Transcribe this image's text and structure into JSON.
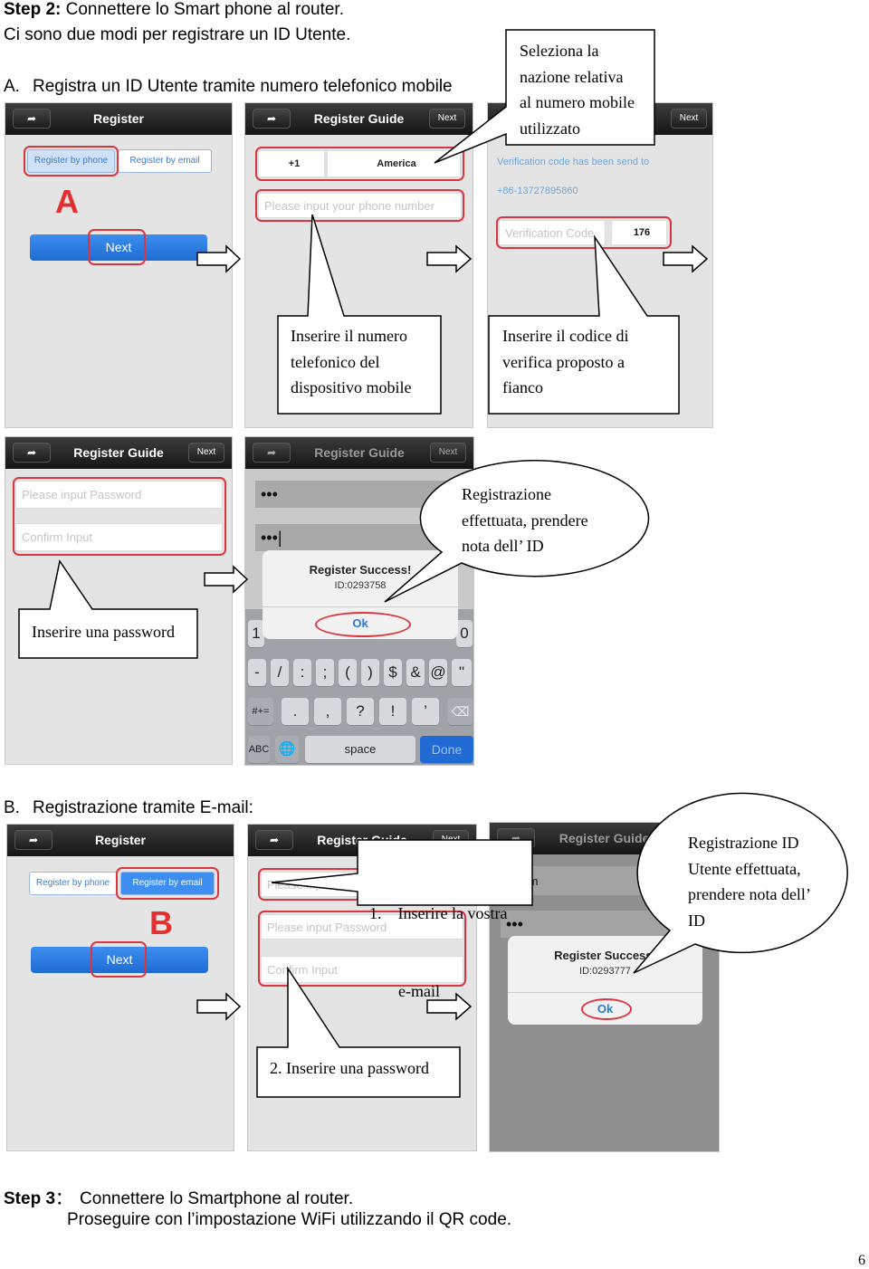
{
  "step2": {
    "label": "Step 2:",
    "text": " Connettere lo Smart phone al router."
  },
  "intro": "Ci sono due modi per registrare un ID Utente.",
  "section_a": {
    "marker": "A.",
    "text": "Registra un ID Utente tramite numero telefonico mobile"
  },
  "section_b": {
    "marker": "B.",
    "text": "Registrazione tramite E-mail:"
  },
  "step3": {
    "label": "Step 3",
    "sep": "：",
    "text": "Connettere lo Smartphone al router.",
    "line2": "Proseguire con l’impostazione WiFi utilizzando il QR code."
  },
  "page_number": "6",
  "app": {
    "back_icon": "back-arrow-icon",
    "title_register": "Register",
    "title_guide": "Register Guide",
    "next_small": "Next",
    "by_phone": "Register by phone",
    "by_email": "Register by email",
    "next": "Next",
    "letter_a": "A",
    "letter_b": "B",
    "country_code": "+1",
    "country": "America",
    "phone_placeholder": "Please input your phone number",
    "verify_sent": "Verification code has been send to",
    "verify_number": "+86-13727895860",
    "verify_placeholder": "Verification Code",
    "verify_code": "176",
    "password_placeholder": "Please input Password",
    "confirm_placeholder": "Confirm Input",
    "email_placeholder": "Please input your email",
    "email_partial": "3.com",
    "masked": "•••",
    "masked_cursor": "•••|",
    "success_title": "Register Success!",
    "success_id_a": "ID:0293758",
    "success_id_b": "ID:0293777",
    "ok": "Ok",
    "keyboard": {
      "row1": [
        "1",
        "",
        "",
        "",
        "",
        "",
        "",
        "",
        "",
        "0"
      ],
      "row2": [
        "-",
        "/",
        ":",
        ";",
        "(",
        ")",
        "$",
        "&",
        "@",
        "\""
      ],
      "row3": [
        "#+=",
        ".",
        ",",
        "?",
        "!",
        "’",
        "⌫"
      ],
      "abc": "ABC",
      "globe_icon": "globe-icon",
      "space": "space",
      "done": "Done"
    }
  },
  "callouts": {
    "select_country": [
      "Seleziona la",
      "nazione relativa",
      "al numero mobile",
      "utilizzato"
    ],
    "enter_phone": [
      "Inserire il numero",
      "telefonico del",
      "dispositivo mobile"
    ],
    "enter_code": [
      "Inserire il codice di",
      "verifica proposto a",
      "fianco"
    ],
    "success_a": [
      "Registrazione",
      "effettuata, prendere",
      "nota dell’ ID"
    ],
    "enter_password": [
      "Inserire una password"
    ],
    "enter_email": [
      "1.    Inserire la vostra",
      "e-mail"
    ],
    "enter_password_b": [
      "2. Inserire una password"
    ],
    "success_b": [
      "Registrazione ID",
      "Utente effettuata,",
      "prendere nota dell’",
      "ID"
    ]
  },
  "colors": {
    "highlight_red": "#d9363e",
    "button_blue": "#2a7ad6",
    "header_dark": "#1c1c1c"
  }
}
